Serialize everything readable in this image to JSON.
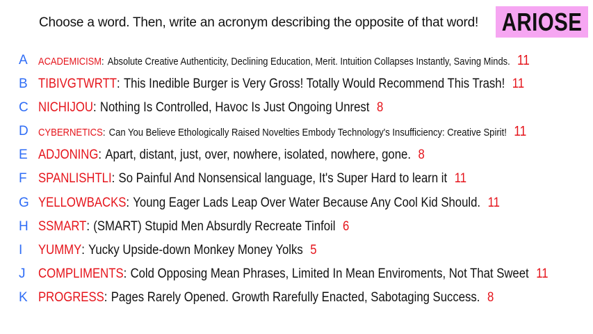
{
  "prompt": "Choose a word. Then, write an acronym describing the opposite of that word!",
  "brand": "ARIOSE",
  "colors": {
    "letter": "#2f6df6",
    "word": "#e5141b",
    "count": "#e5141b",
    "text": "#111111",
    "brand_bg": "#f6a6f2"
  },
  "entries": [
    {
      "letter": "A",
      "word": "ACADEMICISM",
      "sep": ":",
      "acronym": "Absolute Creative Authenticity, Declining Education, Merit. Intuition Collapses Instantly, Saving Minds.",
      "count": "11"
    },
    {
      "letter": "B",
      "word": "TIBIVGTWRTT",
      "sep": ":",
      "acronym": "This Inedible Burger is Very Gross! Totally Would Recommend This Trash!",
      "count": "11"
    },
    {
      "letter": "C",
      "word": "NICHIJOU",
      "sep": ":",
      "acronym": "Nothing Is Controlled, Havoc Is Just Ongoing Unrest",
      "count": "8"
    },
    {
      "letter": "D",
      "word": "CYBERNETICS",
      "sep": ":",
      "acronym": "Can You Believe Ethologically Raised Novelties Embody Technology's Insufficiency: Creative Spirit!",
      "count": "11"
    },
    {
      "letter": "E",
      "word": "ADJONING",
      "sep": ":",
      "acronym": "Apart, distant, just, over, nowhere, isolated, nowhere, gone.",
      "count": "8"
    },
    {
      "letter": "F",
      "word": "SPANLISHTLI",
      "sep": ":",
      "acronym": "So Painful And Nonsensical language, It's Super Hard to learn it",
      "count": "11"
    },
    {
      "letter": "G",
      "word": "YELLOWBACKS",
      "sep": ":",
      "acronym": "Young Eager Lads Leap Over Water Because Any Cool Kid Should.",
      "count": "11"
    },
    {
      "letter": "H",
      "word": "SSMART",
      "sep": ":",
      "acronym": "(SMART) Stupid Men Absurdly Recreate Tinfoil",
      "count": "6"
    },
    {
      "letter": "I",
      "word": "YUMMY",
      "sep": ":",
      "acronym": "Yucky Upside-down Monkey Money Yolks",
      "count": "5"
    },
    {
      "letter": "J",
      "word": "COMPLIMENTS",
      "sep": ":",
      "acronym": "Cold Opposing Mean Phrases, Limited In Mean Enviroments, Not That Sweet",
      "count": "11"
    },
    {
      "letter": "K",
      "word": "PROGRESS",
      "sep": ":",
      "acronym": "Pages Rarely Opened. Growth Rarefully Enacted, Sabotaging Success.",
      "count": "8"
    }
  ]
}
